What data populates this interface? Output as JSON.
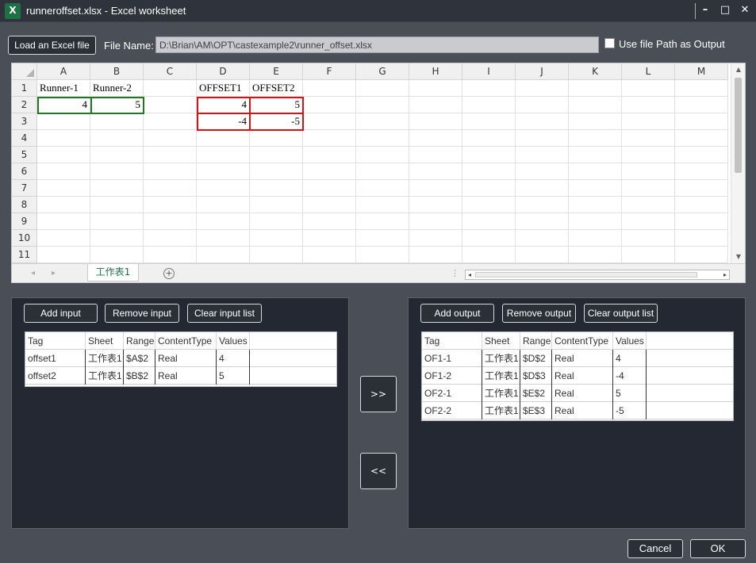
{
  "window": {
    "title": "runneroffset.xlsx - Excel worksheet",
    "app_icon": "excel-icon",
    "minimize": "–",
    "maximize": "□",
    "close": "✕"
  },
  "file": {
    "load_button": "Load an Excel file",
    "name_label": "File Name:",
    "path": "D:\\Brian\\AM\\OPT\\castexample2\\runner_offset.xlsx",
    "use_path_label": "Use file Path as Output",
    "use_path_checked": false
  },
  "sheet": {
    "columns": [
      "A",
      "B",
      "C",
      "D",
      "E",
      "F",
      "G",
      "H",
      "I",
      "J",
      "K",
      "L",
      "M"
    ],
    "rows": [
      "1",
      "2",
      "3",
      "4",
      "5",
      "6",
      "7",
      "8",
      "9",
      "10",
      "11"
    ],
    "cells": {
      "A1": "Runner-1",
      "B1": "Runner-2",
      "D1": "OFFSET1",
      "E1": "OFFSET2",
      "A2": "4",
      "B2": "5",
      "D2": "4",
      "E2": "5",
      "D3": "-4",
      "E3": "-5"
    },
    "tab_name": "工作表1",
    "add_sheet": "+",
    "nav_prev": "◂",
    "nav_next": "▸",
    "dots": "⋮",
    "up_arrow": "▲",
    "down_arrow": "▼",
    "left_arrow": "◂",
    "right_arrow": "▸"
  },
  "inputs": {
    "add_button": "Add input",
    "remove_button": "Remove input",
    "clear_button": "Clear input list",
    "headers": [
      "Tag",
      "Sheet",
      "Range",
      "ContentType",
      "Values"
    ],
    "rows": [
      [
        "offset1",
        "工作表1",
        "$A$2",
        "Real",
        "4"
      ],
      [
        "offset2",
        "工作表1",
        "$B$2",
        "Real",
        "5"
      ]
    ]
  },
  "transfer": {
    "forward": ">>",
    "back": "<<"
  },
  "outputs": {
    "add_button": "Add output",
    "remove_button": "Remove output",
    "clear_button": "Clear output list",
    "headers": [
      "Tag",
      "Sheet",
      "Range",
      "ContentType",
      "Values"
    ],
    "rows": [
      [
        "OF1-1",
        "工作表1",
        "$D$2",
        "Real",
        "4"
      ],
      [
        "OF1-2",
        "工作表1",
        "$D$3",
        "Real",
        "-4"
      ],
      [
        "OF2-1",
        "工作表1",
        "$E$2",
        "Real",
        "5"
      ],
      [
        "OF2-2",
        "工作表1",
        "$E$3",
        "Real",
        "-5"
      ]
    ]
  },
  "footer": {
    "cancel": "Cancel",
    "ok": "OK"
  }
}
